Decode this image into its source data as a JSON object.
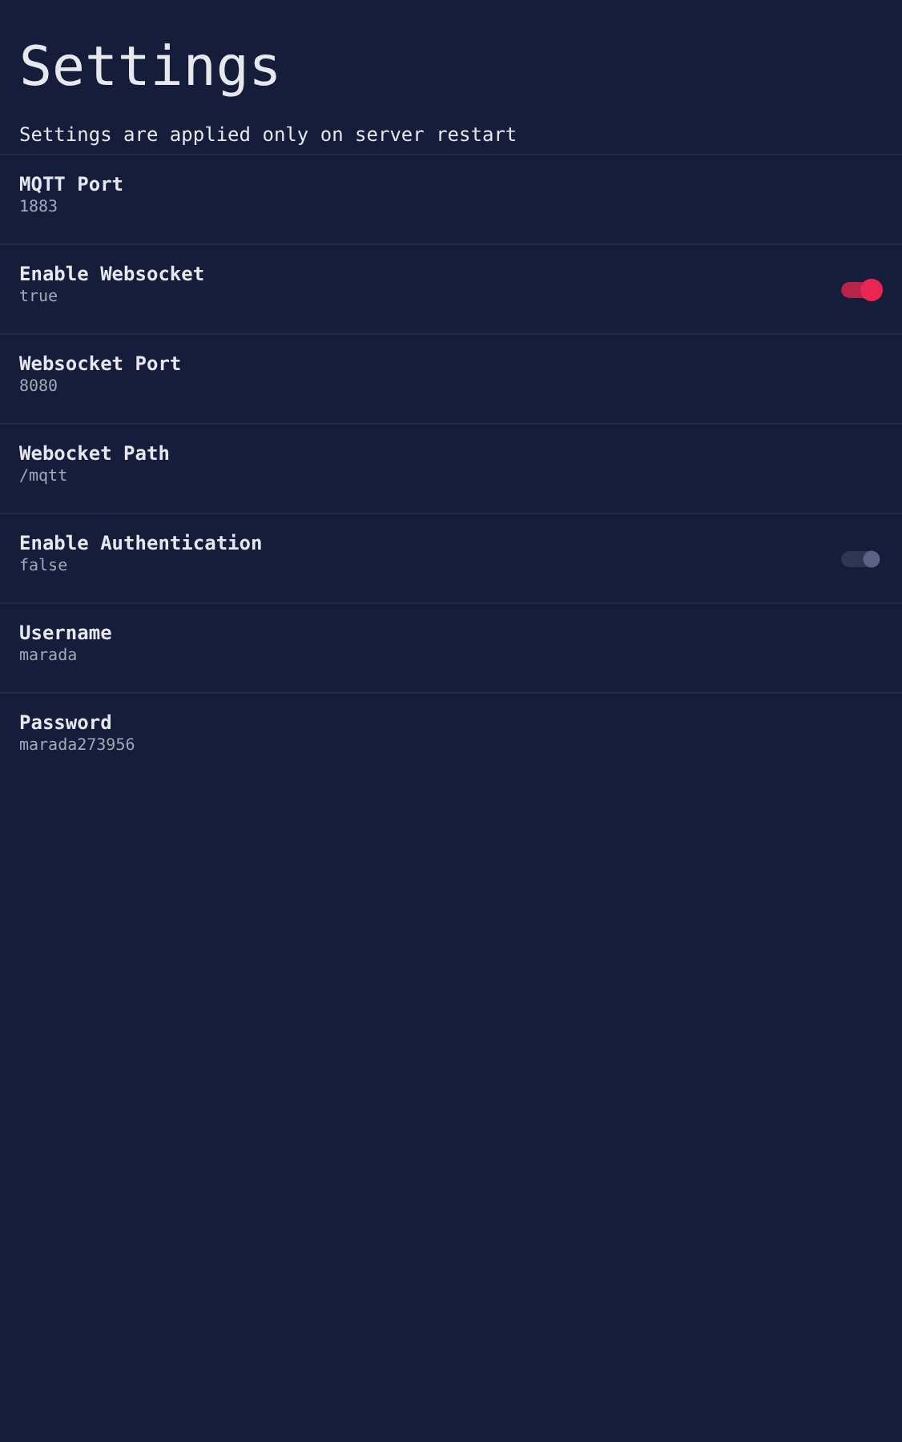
{
  "title": "Settings",
  "notice": "Settings are applied only on server restart",
  "settings": [
    {
      "kind": "text",
      "label": "MQTT Port",
      "value": "1883"
    },
    {
      "kind": "toggle",
      "label": "Enable Websocket",
      "value": "true",
      "on": true
    },
    {
      "kind": "text",
      "label": "Websocket Port",
      "value": "8080"
    },
    {
      "kind": "text",
      "label": "Webocket Path",
      "value": "/mqtt"
    },
    {
      "kind": "toggle",
      "label": "Enable Authentication",
      "value": "false",
      "on": false
    },
    {
      "kind": "text",
      "label": "Username",
      "value": "marada"
    },
    {
      "kind": "text",
      "label": "Password",
      "value": "marada273956"
    }
  ]
}
